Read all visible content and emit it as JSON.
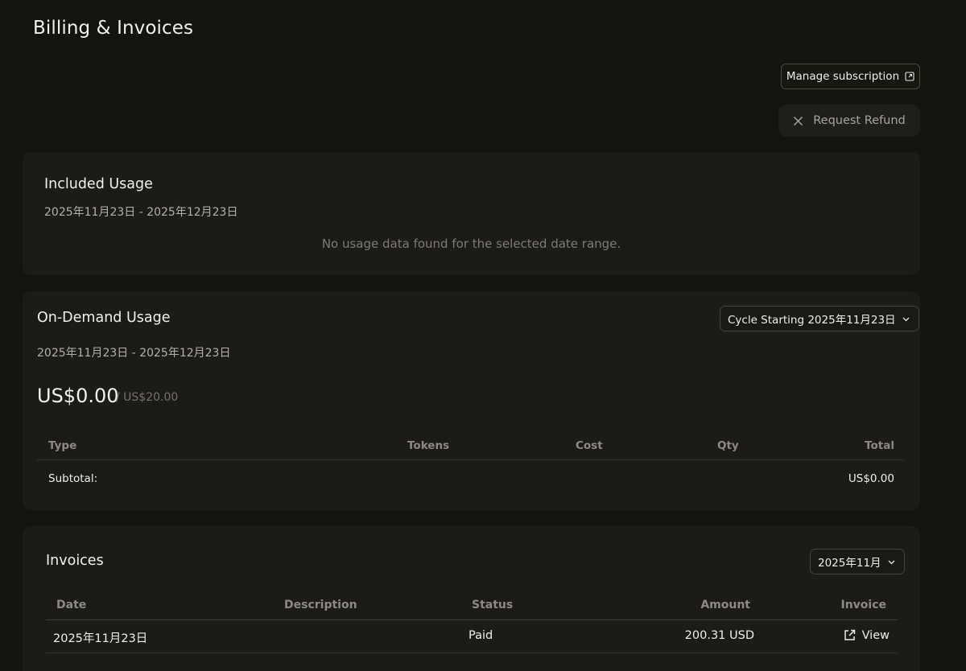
{
  "page": {
    "title": "Billing & Invoices"
  },
  "actions": {
    "manage_subscription": "Manage subscription",
    "request_refund": "Request Refund"
  },
  "included_usage": {
    "title": "Included Usage",
    "date_range": "2025年11月23日 - 2025年12月23日",
    "empty_message": "No usage data found for the selected date range."
  },
  "on_demand_usage": {
    "title": "On-Demand Usage",
    "cycle_select": "Cycle Starting 2025年11月23日",
    "date_range": "2025年11月23日 - 2025年12月23日",
    "amount": "US$0.00",
    "limit": "/ US$20.00",
    "table": {
      "columns": [
        "Type",
        "Tokens",
        "Cost",
        "Qty",
        "Total"
      ],
      "subtotal_label": "Subtotal:",
      "subtotal_value": "US$0.00"
    }
  },
  "invoices": {
    "title": "Invoices",
    "month_select": "2025年11月",
    "columns": [
      "Date",
      "Description",
      "Status",
      "Amount",
      "Invoice"
    ],
    "rows": [
      {
        "date": "2025年11月23日",
        "description": "",
        "status": "Paid",
        "amount": "200.31 USD",
        "link": "View"
      }
    ]
  }
}
